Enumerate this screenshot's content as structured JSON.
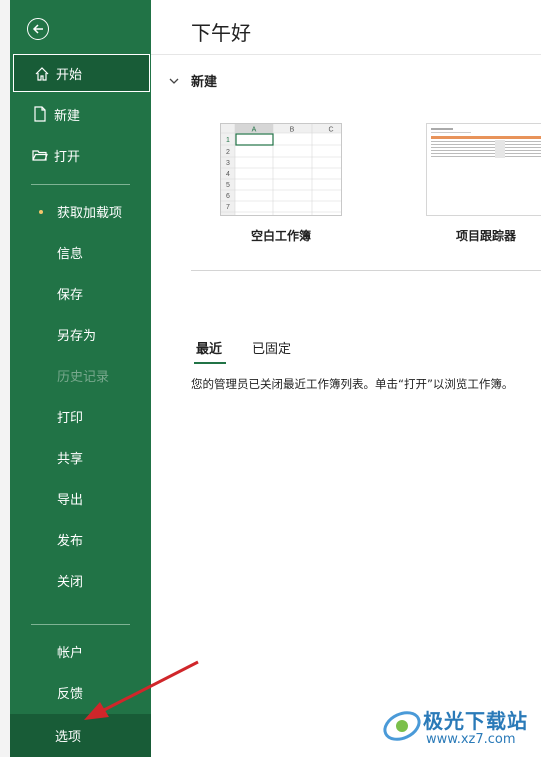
{
  "sidebar": {
    "back_icon": "back-arrow-icon",
    "items_top": [
      {
        "label": "开始",
        "icon": "home-icon"
      },
      {
        "label": "新建",
        "icon": "new-file-icon"
      },
      {
        "label": "打开",
        "icon": "open-folder-icon"
      }
    ],
    "items_mid": [
      {
        "label": "获取加载项",
        "dot_color": "#f4c56b"
      },
      {
        "label": "信息"
      },
      {
        "label": "保存"
      },
      {
        "label": "另存为"
      },
      {
        "label": "历史记录",
        "disabled": true
      },
      {
        "label": "打印"
      },
      {
        "label": "共享"
      },
      {
        "label": "导出"
      },
      {
        "label": "发布"
      },
      {
        "label": "关闭"
      }
    ],
    "items_bottom": [
      {
        "label": "帐户"
      },
      {
        "label": "反馈"
      },
      {
        "label": "选项"
      }
    ]
  },
  "main": {
    "greeting": "下午好",
    "new_section": {
      "title": "新建"
    },
    "templates": [
      {
        "label": "空白工作簿",
        "columns": [
          "A",
          "B",
          "C"
        ],
        "rows": [
          "1",
          "2",
          "3",
          "4",
          "5",
          "6",
          "7"
        ]
      },
      {
        "label": "项目跟踪器"
      }
    ],
    "tabs": [
      {
        "label": "最近",
        "active": true
      },
      {
        "label": "已固定",
        "active": false
      }
    ],
    "recent_note": "您的管理员已关闭最近工作簿列表。单击“打开”以浏览工作簿。"
  },
  "watermark": {
    "text": "极光下载站",
    "url": "www.xz7.com"
  },
  "colors": {
    "sidebar": "#217346",
    "sidebar_selected": "#185c37",
    "accent": "#217346",
    "arrow": "#d0262a"
  }
}
